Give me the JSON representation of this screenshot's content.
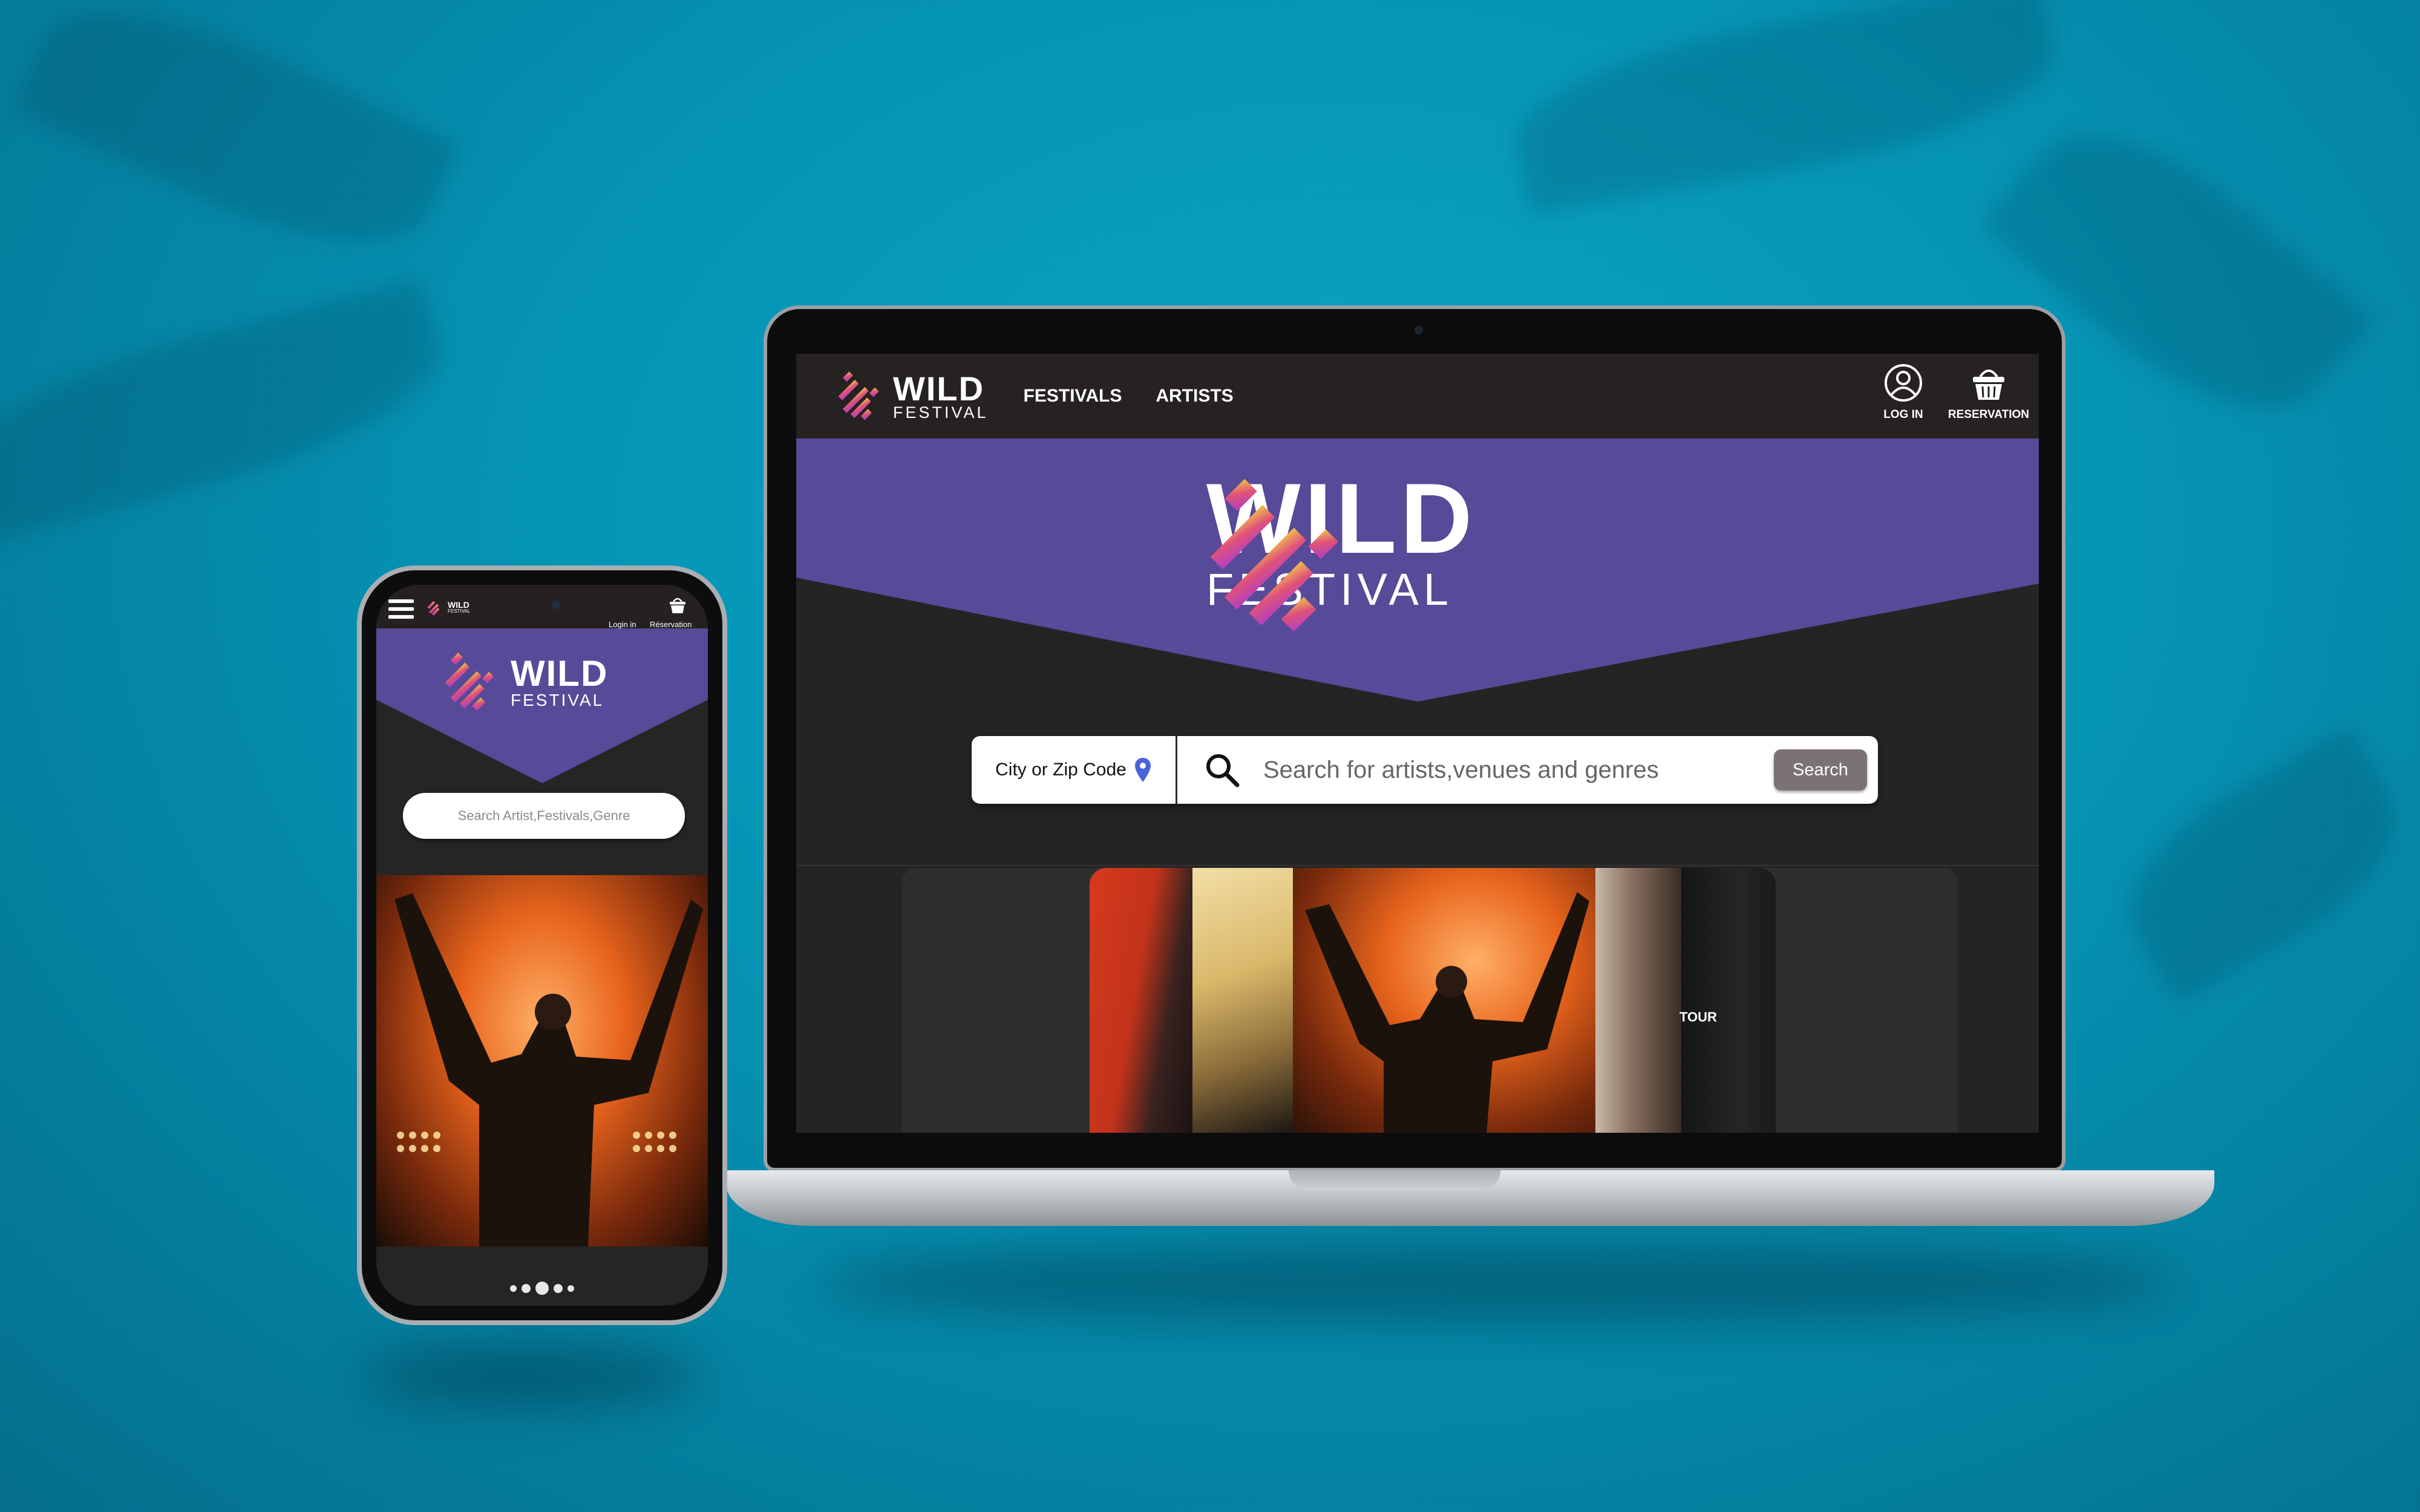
{
  "desktop": {
    "nav": {
      "logo_wild": "WILD",
      "logo_festival": "FESTIVAL",
      "festivals": "FESTIVALS",
      "artists": "ARTISTS",
      "login": "LOG IN",
      "reservation": "RESERVATION"
    },
    "hero": {
      "logo_wild": "WILD",
      "logo_festival": "FESTIVAL"
    },
    "search": {
      "location_label": "City or Zip Code",
      "placeholder": "Search for artists,venues and genres",
      "button": "Search"
    },
    "carousel": {
      "caption_fragment": "TOUR"
    }
  },
  "mobile": {
    "nav": {
      "logo_wild": "WILD",
      "logo_festival": "FESTIVAL",
      "login": "Login in",
      "reservation": "Réservation"
    },
    "hero": {
      "logo_wild": "WILD",
      "logo_festival": "FESTIVAL"
    },
    "search": {
      "placeholder": "Search Artist,Festivals,Genre"
    },
    "carousel": {
      "slide_count": 5,
      "active_index": 2
    }
  },
  "colors": {
    "background": "#0592b3",
    "hero_purple": "#574a98",
    "nav_dark": "#272222",
    "body_dark": "#242424",
    "search_button": "#7b7373",
    "logo_gradient": [
      "#b13fc2",
      "#e0527a",
      "#f2c14a"
    ]
  },
  "icons": [
    "location-pin-icon",
    "search-icon",
    "user-icon",
    "basket-icon",
    "hamburger-icon"
  ]
}
